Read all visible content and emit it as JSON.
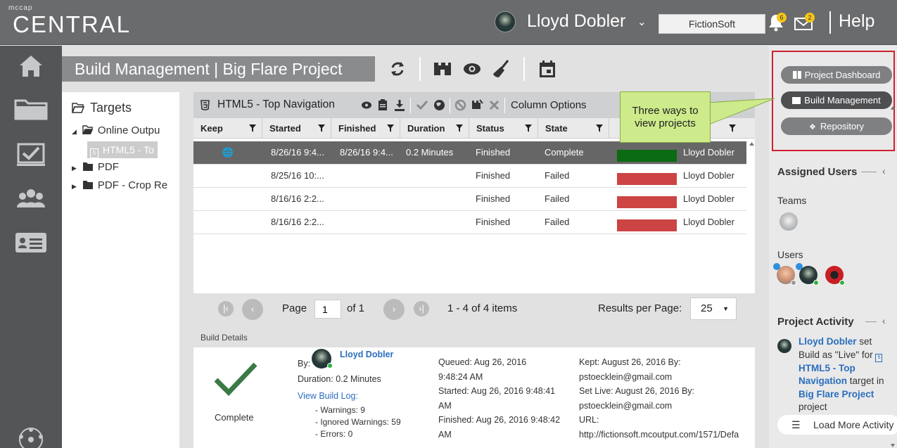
{
  "header": {
    "logo_small": "mccap",
    "logo_big": "CENTRAL",
    "user_name": "Lloyd Dobler",
    "org": "FictionSoft",
    "notifications_count": "6",
    "messages_count": "2",
    "help_label": "Help"
  },
  "sidebar": {
    "items": [
      {
        "icon": "home-icon"
      },
      {
        "icon": "folder-icon"
      },
      {
        "icon": "checklist-icon"
      },
      {
        "icon": "users-icon"
      },
      {
        "icon": "contact-card-icon"
      },
      {
        "icon": "network-icon"
      }
    ]
  },
  "page": {
    "title": "Build Management  |  Big Flare Project"
  },
  "targets": {
    "title": "Targets",
    "items": [
      {
        "label": "Online Outpu"
      },
      {
        "label": "HTML5 - To"
      },
      {
        "label": "PDF"
      },
      {
        "label": "PDF - Crop Re"
      }
    ]
  },
  "grid": {
    "title": "HTML5 - Top Navigation",
    "column_options_label": "Column Options",
    "columns": [
      "Keep",
      "Started",
      "Finished",
      "Duration",
      "Status",
      "State",
      ""
    ],
    "rows": [
      {
        "keep": "🌐",
        "started": "8/26/16 9:4...",
        "finished": "8/26/16 9:4...",
        "duration": "0.2 Minutes",
        "status": "Finished",
        "state": "Complete",
        "user": "Lloyd Dobler",
        "bar_color": "#0a6b12",
        "selected": true
      },
      {
        "keep": "",
        "started": "8/25/16 10:...",
        "finished": "",
        "duration": "",
        "status": "Finished",
        "state": "Failed",
        "user": "Lloyd Dobler",
        "bar_color": "#cc4444",
        "selected": false
      },
      {
        "keep": "",
        "started": "8/16/16 2:2...",
        "finished": "",
        "duration": "",
        "status": "Finished",
        "state": "Failed",
        "user": "Lloyd Dobler",
        "bar_color": "#cc4444",
        "selected": false
      },
      {
        "keep": "",
        "started": "8/16/16 2:2...",
        "finished": "",
        "duration": "",
        "status": "Finished",
        "state": "Failed",
        "user": "Lloyd Dobler",
        "bar_color": "#cc4444",
        "selected": false
      }
    ]
  },
  "pager": {
    "page_label": "Page",
    "page_value": "1",
    "of_label": "of 1",
    "items_label": "1 - 4 of 4 items",
    "results_label": "Results per Page:",
    "results_value": "25"
  },
  "build_details": {
    "heading": "Build Details",
    "status_label": "Complete",
    "by_label": "By:",
    "by_user": "Lloyd Dobler",
    "duration": "Duration: 0.2 Minutes",
    "view_log": "View Build Log:",
    "warnings": "- Warnings: 9",
    "ignored": "- Ignored Warnings: 59",
    "errors": "- Errors: 0",
    "queued_1": "Queued: Aug 26, 2016",
    "queued_2": "9:48:24 AM",
    "started_1": "Started: Aug 26, 2016 9:48:41",
    "started_2": "AM",
    "finished_1": "Finished: Aug 26, 2016 9:48:42",
    "finished_2": "AM",
    "kept_1": "Kept: August 26, 2016 By:",
    "kept_2": "pstoecklein@gmail.com",
    "live_1": "Set Live: August 26, 2016 By:",
    "live_2": "pstoecklein@gmail.com",
    "url_label": "URL:",
    "url": "http://fictionsoft.mcoutput.com/1571/Defa"
  },
  "right_panel": {
    "buttons": [
      "Project Dashboard",
      "Build Management",
      "Repository"
    ],
    "assigned_users": "Assigned Users",
    "teams": "Teams",
    "users": "Users",
    "project_activity": "Project Activity",
    "activity": {
      "user": "Lloyd Dobler",
      "t1": " set Build as \"Live\" for ",
      "target": "HTML5 - Top Navigation",
      "t2": " target in ",
      "project": "Big Flare Project",
      "t3": " project"
    },
    "load_more": "Load More Activity"
  },
  "callout": {
    "text": "Three ways to view projects",
    "color": "#cdeb8b"
  },
  "colors": {
    "accent_red": "#d02030",
    "link_blue": "#2a6ebd",
    "complete_green": "#0a6b12",
    "failed_red": "#cc4444"
  }
}
